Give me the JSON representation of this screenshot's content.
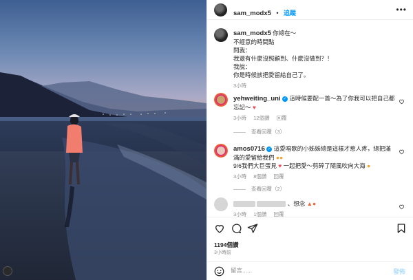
{
  "owner": {
    "username": "sam_modx5",
    "follow_label": "追蹤",
    "more_icon": "more-horizontal-icon"
  },
  "caption": {
    "username": "sam_modx5",
    "lines": [
      "你總在～",
      "不經意的時間點",
      "問我：",
      "我還有什麼沒照顧到、什麼沒做到？！",
      "我說：",
      "你是時候該把愛留給自己了。"
    ],
    "time": "3小時"
  },
  "comments": [
    {
      "username": "yehweiting_uni",
      "verified": true,
      "lines": [
        "這時候要配一首～為了你我可以把自己都",
        "忘記～"
      ],
      "time": "3小時",
      "likes": "12個讚",
      "reply": "回覆",
      "view_replies": "查看回覆（3）"
    },
    {
      "username": "amos0716",
      "verified": true,
      "lines": [
        "這愛唱歌的小姊姊總是這樣才惹人疼，總把滿",
        "滿的愛留給我們",
        "9/6我們大巨蛋見",
        "一起把愛～剪碎了隨風吹向大海"
      ],
      "time": "3小時",
      "likes": "8個讚",
      "reply": "回覆",
      "view_replies": "查看回覆（2）"
    },
    {
      "suffix": "、想念",
      "time": "3小時",
      "likes": "1個讚",
      "reply": "回覆"
    }
  ],
  "actions": {
    "likes_count": "1194個讚",
    "post_time": "3小時前"
  },
  "comment_box": {
    "placeholder": "留言......",
    "post_label": "發佈"
  },
  "colors": {
    "accent": "#0095f6",
    "heart_red": "#ed4956",
    "muted": "#8e8e8e"
  }
}
